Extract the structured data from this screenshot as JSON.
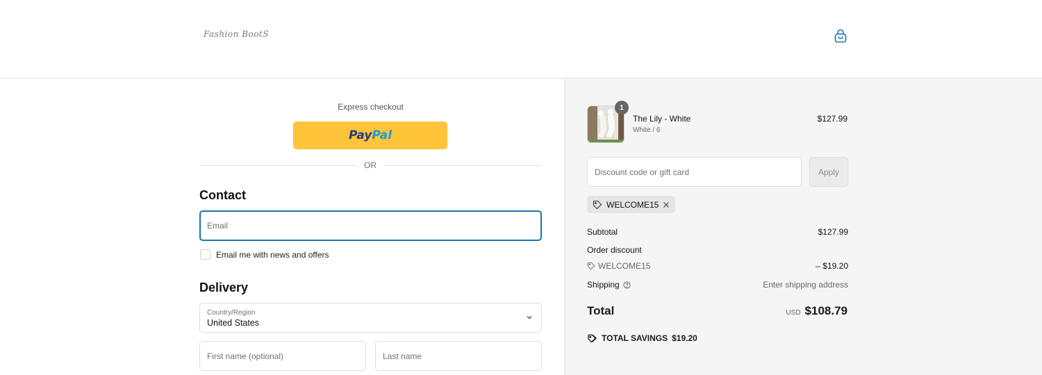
{
  "header": {
    "logo_text": "Fashion BootS",
    "cart_icon": "shopping-bag-icon"
  },
  "express": {
    "label": "Express checkout",
    "paypal_pay": "Pay",
    "paypal_pal": "Pal",
    "or_text": "OR"
  },
  "contact": {
    "title": "Contact",
    "email_placeholder": "Email",
    "newsletter_label": "Email me with news and offers",
    "newsletter_checked": false
  },
  "delivery": {
    "title": "Delivery",
    "country_label": "Country/Region",
    "country_value": "United States",
    "first_name_placeholder": "First name (optional)",
    "last_name_placeholder": "Last name"
  },
  "order": {
    "item": {
      "quantity": "1",
      "name": "The Lily - White",
      "variant": "White / 6",
      "price": "$127.99"
    },
    "discount_placeholder": "Discount code or gift card",
    "apply_label": "Apply",
    "applied_code": "WELCOME15",
    "subtotal_label": "Subtotal",
    "subtotal_value": "$127.99",
    "order_discount_label": "Order discount",
    "discount_code": "WELCOME15",
    "discount_value": "– $19.20",
    "shipping_label": "Shipping",
    "shipping_value": "Enter shipping address",
    "total_label": "Total",
    "total_currency": "USD",
    "total_value": "$108.79",
    "savings_label": "TOTAL SAVINGS",
    "savings_value": "$19.20"
  },
  "colors": {
    "paypal": "#ffc439",
    "focus_border": "#1773b0",
    "summary_bg": "#f5f5f5"
  }
}
